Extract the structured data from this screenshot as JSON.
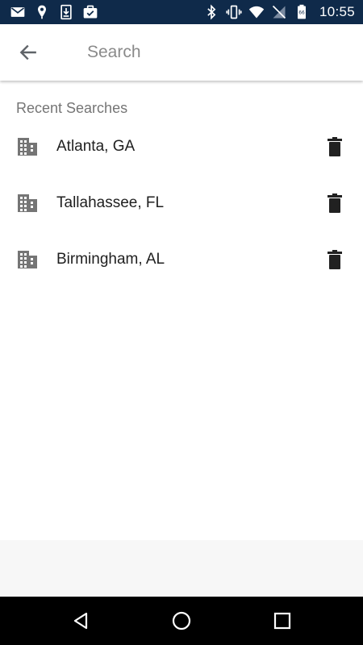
{
  "status_bar": {
    "time": "10:55",
    "left_icons": [
      "gmail-icon",
      "location-pin-icon",
      "download-icon",
      "briefcase-check-icon"
    ],
    "right_icons": [
      "bluetooth-icon",
      "vibrate-icon",
      "wifi-icon",
      "no-sim-icon",
      "battery-icon"
    ]
  },
  "app_bar": {
    "back_icon": "arrow-back-icon",
    "search_placeholder": "Search",
    "search_value": ""
  },
  "recent_searches": {
    "title": "Recent Searches",
    "items": [
      {
        "label": "Atlanta, GA",
        "icon": "building-icon",
        "action_icon": "trash-icon"
      },
      {
        "label": "Tallahassee, FL",
        "icon": "building-icon",
        "action_icon": "trash-icon"
      },
      {
        "label": "Birmingham, AL",
        "icon": "building-icon",
        "action_icon": "trash-icon"
      }
    ]
  },
  "nav_bar": {
    "buttons": [
      "back-triangle-icon",
      "home-circle-icon",
      "recents-square-icon"
    ]
  },
  "colors": {
    "status_bar_bg": "#0f2a4a",
    "nav_bar_bg": "#000000",
    "icon_gray": "#757575",
    "text_dark": "#1f1f1f"
  }
}
